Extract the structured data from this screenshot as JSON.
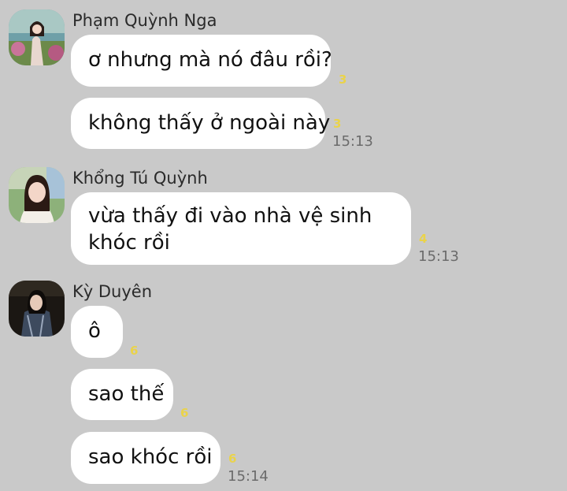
{
  "groups": [
    {
      "sender": "Phạm Quỳnh Nga",
      "messages": [
        {
          "text": "ơ nhưng mà nó đâu rồi?",
          "count": "3"
        },
        {
          "text": "không thấy ở ngoài này",
          "count": "3",
          "time": "15:13"
        }
      ]
    },
    {
      "sender": "Khổng Tú Quỳnh",
      "messages": [
        {
          "line1": "vừa thấy đi vào nhà vệ sinh",
          "line2": "khóc rồi",
          "count": "4",
          "time": "15:13"
        }
      ]
    },
    {
      "sender": "Kỳ Duyên",
      "messages": [
        {
          "text": "ô",
          "count": "6"
        },
        {
          "text": "sao thế",
          "count": "6"
        },
        {
          "text": "sao khóc rồi",
          "count": "6",
          "time": "15:14"
        }
      ]
    }
  ],
  "colors": {
    "background": "#c9c9c9",
    "bubble": "#ffffff",
    "count": "#ead34a",
    "time": "#6b6b6b"
  }
}
